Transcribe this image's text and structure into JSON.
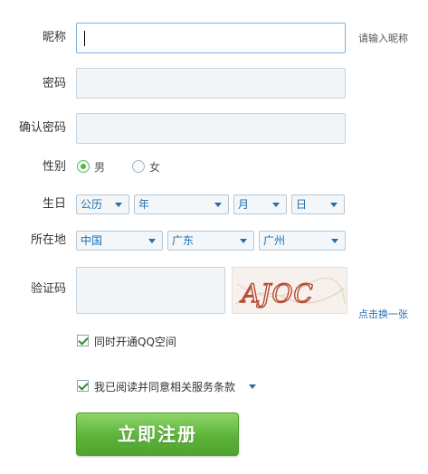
{
  "form": {
    "nickname": {
      "label": "昵称",
      "value": "",
      "hint": "请输入昵称"
    },
    "password": {
      "label": "密码",
      "value": ""
    },
    "confirm_password": {
      "label": "确认密码",
      "value": ""
    },
    "gender": {
      "label": "性别",
      "options": [
        "男",
        "女"
      ],
      "selected": "男"
    },
    "birthday": {
      "label": "生日",
      "calendar": "公历",
      "year": "年",
      "month": "月",
      "day": "日"
    },
    "location": {
      "label": "所在地",
      "country": "中国",
      "province": "广东",
      "city": "广州"
    },
    "captcha": {
      "label": "验证码",
      "value": "",
      "image_text": "AJOC",
      "refresh_label": "点击换一张"
    },
    "open_qzone": {
      "label": "同时开通QQ空间",
      "checked": true
    },
    "agree_terms": {
      "label": "我已阅读并同意相关服务条款",
      "checked": true
    },
    "submit_label": "立即注册"
  },
  "colors": {
    "accent": "#58b43b",
    "link": "#2a6db5",
    "input_border_active": "#7eb1dc"
  }
}
